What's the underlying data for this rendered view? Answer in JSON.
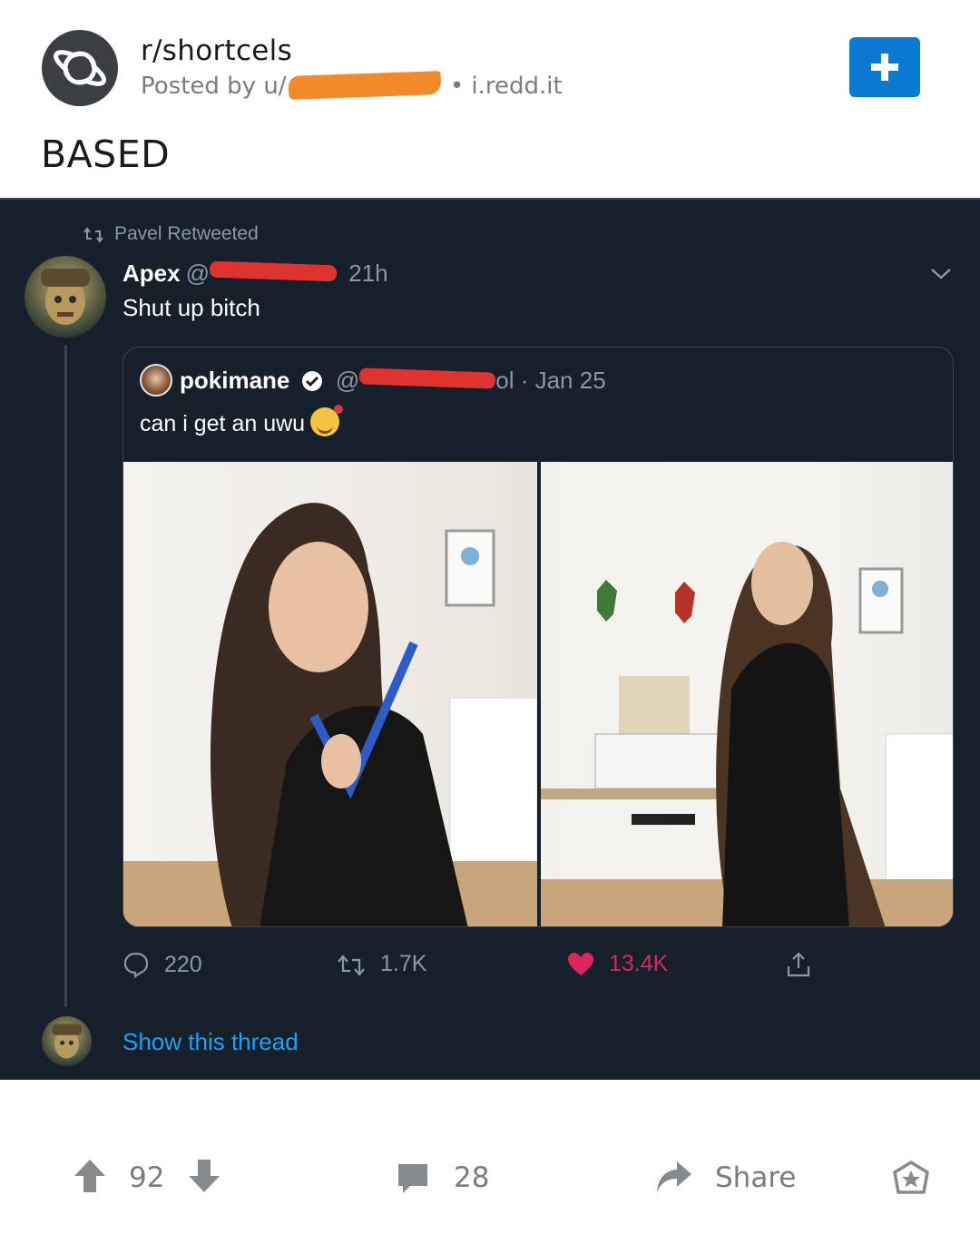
{
  "post": {
    "subreddit": "r/shortcels",
    "posted_by_prefix": "Posted by u/",
    "domain": "• i.redd.it",
    "title": "BASED"
  },
  "tweet": {
    "retweeted_by": "Pavel Retweeted",
    "author_name": "Apex",
    "author_handle_prefix": "@",
    "time": "21h",
    "text": "Shut up bitch",
    "quote": {
      "author_name": "pokimane",
      "handle_prefix": "@",
      "handle_suffix": "ol · Jan 25",
      "text": "can i get an uwu"
    },
    "stats": {
      "replies": "220",
      "retweets": "1.7K",
      "likes": "13.4K"
    },
    "show_thread": "Show this thread"
  },
  "footer": {
    "votes": "92",
    "comments": "28",
    "share": "Share"
  },
  "colors": {
    "tweet_bg": "#15202b",
    "reddit_blue": "#0a79d3",
    "like_red": "#e0245e",
    "link_blue": "#1da1f2",
    "redaction_orange": "#f28a2b",
    "redaction_red": "#e0332f"
  }
}
